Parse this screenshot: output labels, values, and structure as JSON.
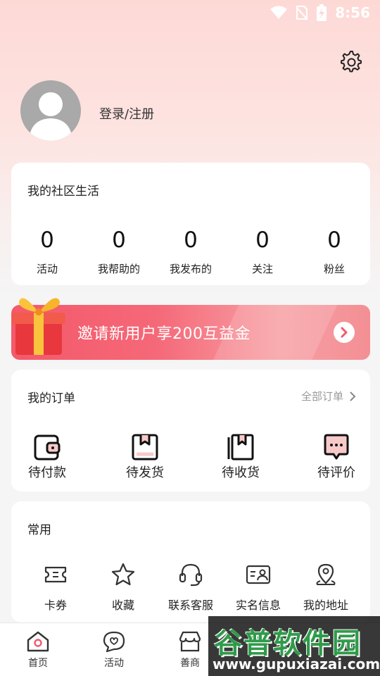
{
  "status_bar": {
    "time": "8:56",
    "icons": [
      "wifi-icon",
      "no-sim-icon",
      "battery-charging-icon"
    ]
  },
  "profile": {
    "login_label": "登录/注册",
    "settings_icon": "gear-icon",
    "avatar_icon": "default-avatar-icon"
  },
  "community": {
    "title": "我的社区生活",
    "stats": [
      {
        "value": "0",
        "label": "活动"
      },
      {
        "value": "0",
        "label": "我帮助的"
      },
      {
        "value": "0",
        "label": "我发布的"
      },
      {
        "value": "0",
        "label": "关注"
      },
      {
        "value": "0",
        "label": "粉丝"
      }
    ]
  },
  "invite_banner": {
    "text": "邀请新用户享200互益金",
    "icon": "gift-icon",
    "arrow_icon": "chevron-right-icon"
  },
  "orders": {
    "title": "我的订单",
    "all_label": "全部订单",
    "items": [
      {
        "label": "待付款",
        "icon": "wallet-icon"
      },
      {
        "label": "待发货",
        "icon": "package-icon"
      },
      {
        "label": "待收货",
        "icon": "receive-box-icon"
      },
      {
        "label": "待评价",
        "icon": "review-chat-icon"
      }
    ]
  },
  "common": {
    "title": "常用",
    "items": [
      {
        "label": "卡券",
        "icon": "coupon-icon"
      },
      {
        "label": "收藏",
        "icon": "star-icon"
      },
      {
        "label": "联系客服",
        "icon": "headset-icon"
      },
      {
        "label": "实名信息",
        "icon": "id-card-icon"
      },
      {
        "label": "我的地址",
        "icon": "location-pin-icon"
      }
    ]
  },
  "bottom_nav": {
    "items": [
      {
        "label": "首页",
        "icon": "home-icon"
      },
      {
        "label": "活动",
        "icon": "activity-chat-icon"
      },
      {
        "label": "善商",
        "icon": "shop-icon"
      }
    ]
  },
  "watermark": {
    "title": "谷普软件园",
    "url": "www.gupuxiazai.com"
  },
  "colors": {
    "accent": "#f4596a",
    "header_bg": "#fdd9d6",
    "page_bg": "#f5f5f5"
  }
}
